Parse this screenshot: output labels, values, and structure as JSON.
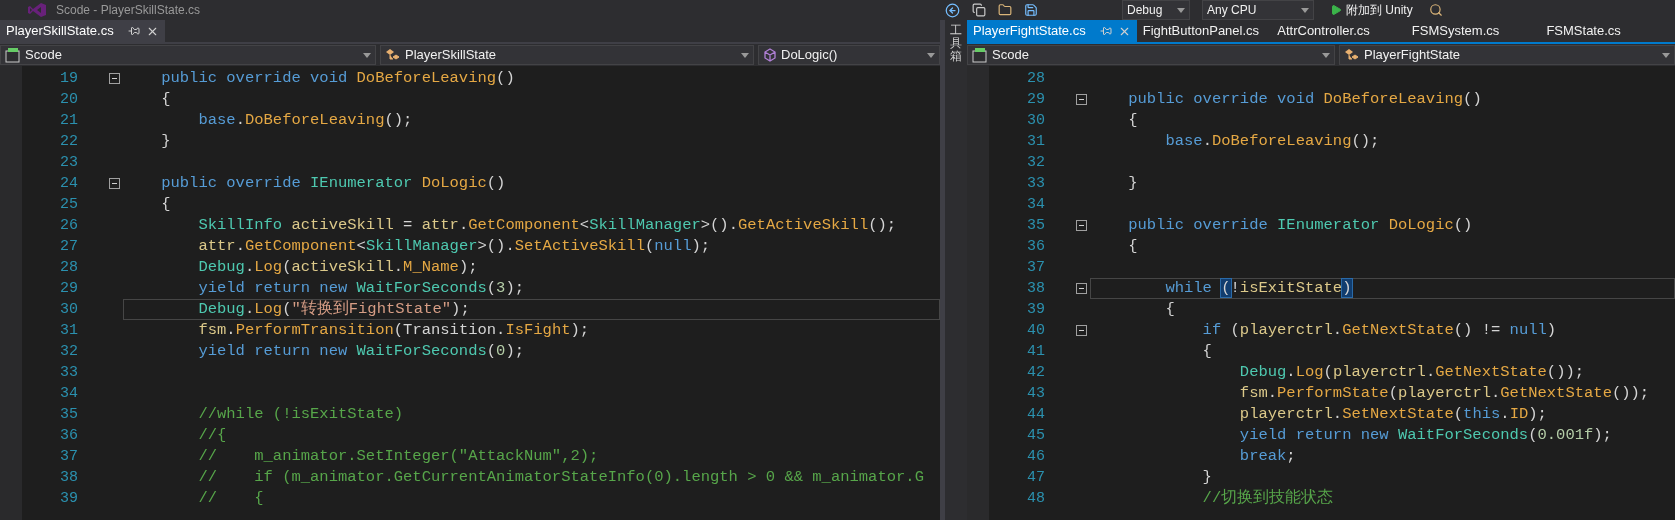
{
  "title_bar": {
    "title": "Scode - PlayerSkillState.cs"
  },
  "toolbar": {
    "configuration": "Debug",
    "platform": "Any CPU",
    "start_button": "附加到 Unity"
  },
  "toolbox_tab": "工具箱",
  "panes": [
    {
      "focused": false,
      "tabs": [
        {
          "label": "PlayerSkillState.cs",
          "selected": true
        }
      ],
      "navigation": [
        {
          "kind": "project",
          "label": "Scode"
        },
        {
          "kind": "class",
          "label": "PlayerSkillState"
        },
        {
          "kind": "member",
          "label": "DoLogic()"
        }
      ],
      "lines": [
        {
          "number": "19",
          "fold": true,
          "current": false,
          "tokens": [
            {
              "kind": "kw",
              "text": "    public override void "
            },
            {
              "kind": "method",
              "text": "DoBeforeLeaving"
            },
            {
              "kind": "plain",
              "text": "()"
            }
          ]
        },
        {
          "number": "20",
          "fold": false,
          "current": false,
          "tokens": [
            {
              "kind": "plain",
              "text": "    {"
            }
          ]
        },
        {
          "number": "21",
          "fold": false,
          "current": false,
          "tokens": [
            {
              "kind": "kw",
              "text": "        base"
            },
            {
              "kind": "plain",
              "text": "."
            },
            {
              "kind": "method",
              "text": "DoBeforeLeaving"
            },
            {
              "kind": "plain",
              "text": "();"
            }
          ]
        },
        {
          "number": "22",
          "fold": false,
          "current": false,
          "tokens": [
            {
              "kind": "plain",
              "text": "    }"
            }
          ]
        },
        {
          "number": "23",
          "fold": false,
          "current": false
        },
        {
          "number": "24",
          "fold": true,
          "current": false,
          "tokens": [
            {
              "kind": "kw",
              "text": "    public override "
            },
            {
              "kind": "type",
              "text": "IEnumerator "
            },
            {
              "kind": "method",
              "text": "DoLogic"
            },
            {
              "kind": "plain",
              "text": "()"
            }
          ]
        },
        {
          "number": "25",
          "fold": false,
          "current": false,
          "tokens": [
            {
              "kind": "plain",
              "text": "    {"
            }
          ]
        },
        {
          "number": "26",
          "fold": false,
          "current": false,
          "tokens": [
            {
              "kind": "type",
              "text": "        SkillInfo "
            },
            {
              "kind": "ident",
              "text": "activeSkill"
            },
            {
              "kind": "plain",
              "text": " = "
            },
            {
              "kind": "ident",
              "text": "attr"
            },
            {
              "kind": "plain",
              "text": "."
            },
            {
              "kind": "method",
              "text": "GetComponent"
            },
            {
              "kind": "plain",
              "text": "<"
            },
            {
              "kind": "type",
              "text": "SkillManager"
            },
            {
              "kind": "plain",
              "text": ">()."
            },
            {
              "kind": "method",
              "text": "GetActiveSkill"
            },
            {
              "kind": "plain",
              "text": "();"
            }
          ]
        },
        {
          "number": "27",
          "fold": false,
          "current": false,
          "tokens": [
            {
              "kind": "ident",
              "text": "        attr"
            },
            {
              "kind": "plain",
              "text": "."
            },
            {
              "kind": "method",
              "text": "GetComponent"
            },
            {
              "kind": "plain",
              "text": "<"
            },
            {
              "kind": "type",
              "text": "SkillManager"
            },
            {
              "kind": "plain",
              "text": ">()."
            },
            {
              "kind": "method",
              "text": "SetActiveSkill"
            },
            {
              "kind": "plain",
              "text": "("
            },
            {
              "kind": "kw",
              "text": "null"
            },
            {
              "kind": "plain",
              "text": ");"
            }
          ]
        },
        {
          "number": "28",
          "fold": false,
          "current": false,
          "tokens": [
            {
              "kind": "type",
              "text": "        Debug"
            },
            {
              "kind": "plain",
              "text": "."
            },
            {
              "kind": "method",
              "text": "Log"
            },
            {
              "kind": "plain",
              "text": "("
            },
            {
              "kind": "ident",
              "text": "activeSkill"
            },
            {
              "kind": "plain",
              "text": "."
            },
            {
              "kind": "method",
              "text": "M_Name"
            },
            {
              "kind": "plain",
              "text": ");"
            }
          ]
        },
        {
          "number": "29",
          "fold": false,
          "current": false,
          "tokens": [
            {
              "kind": "kw",
              "text": "        yield return new "
            },
            {
              "kind": "type",
              "text": "WaitForSeconds"
            },
            {
              "kind": "plain",
              "text": "("
            },
            {
              "kind": "num",
              "text": "3"
            },
            {
              "kind": "plain",
              "text": ");"
            }
          ]
        },
        {
          "number": "30",
          "fold": false,
          "current": true,
          "tokens": [
            {
              "kind": "type",
              "text": "        Debug"
            },
            {
              "kind": "plain",
              "text": "."
            },
            {
              "kind": "method",
              "text": "Log"
            },
            {
              "kind": "plain",
              "text": "("
            },
            {
              "kind": "str",
              "text": "\"转换到FightState\""
            },
            {
              "kind": "plain",
              "text": ");"
            }
          ]
        },
        {
          "number": "31",
          "fold": false,
          "current": false,
          "tokens": [
            {
              "kind": "ident",
              "text": "        fsm"
            },
            {
              "kind": "plain",
              "text": "."
            },
            {
              "kind": "method",
              "text": "PerformTransition"
            },
            {
              "kind": "plain",
              "text": "(Transition."
            },
            {
              "kind": "method",
              "text": "IsFight"
            },
            {
              "kind": "plain",
              "text": ");"
            }
          ]
        },
        {
          "number": "32",
          "fold": false,
          "current": false,
          "tokens": [
            {
              "kind": "kw",
              "text": "        yield return new "
            },
            {
              "kind": "type",
              "text": "WaitForSeconds"
            },
            {
              "kind": "plain",
              "text": "("
            },
            {
              "kind": "num",
              "text": "0"
            },
            {
              "kind": "plain",
              "text": ");"
            }
          ]
        },
        {
          "number": "33",
          "fold": false,
          "current": false
        },
        {
          "number": "34",
          "fold": false,
          "current": false
        },
        {
          "number": "35",
          "fold": false,
          "current": false,
          "tokens": [
            {
              "kind": "comment",
              "text": "        //while (!isExitState)"
            }
          ]
        },
        {
          "number": "36",
          "fold": false,
          "current": false,
          "tokens": [
            {
              "kind": "comment",
              "text": "        //{"
            }
          ]
        },
        {
          "number": "37",
          "fold": false,
          "current": false,
          "tokens": [
            {
              "kind": "comment",
              "text": "        //    m_animator.SetInteger(\"AttackNum\",2);"
            }
          ]
        },
        {
          "number": "38",
          "fold": false,
          "current": false,
          "tokens": [
            {
              "kind": "comment",
              "text": "        //    if (m_animator.GetCurrentAnimatorStateInfo(0).length > 0 && m_animator.G"
            }
          ]
        },
        {
          "number": "39",
          "fold": false,
          "current": false,
          "tokens": [
            {
              "kind": "comment",
              "text": "        //    {"
            }
          ]
        }
      ]
    },
    {
      "focused": true,
      "tabs": [
        {
          "label": "PlayerFightState.cs",
          "selected": true
        },
        {
          "label": "FightButtonPanel.cs",
          "selected": false
        },
        {
          "label": "AttrController.cs",
          "selected": false
        },
        {
          "label": "FSMSystem.cs",
          "selected": false
        },
        {
          "label": "FSMState.cs",
          "selected": false
        }
      ],
      "navigation": [
        {
          "kind": "project",
          "label": "Scode"
        },
        {
          "kind": "class",
          "label": "PlayerFightState"
        }
      ],
      "lines": [
        {
          "number": "28",
          "fold": false,
          "current": false
        },
        {
          "number": "29",
          "fold": true,
          "current": false,
          "tokens": [
            {
              "kind": "kw",
              "text": "    public override void "
            },
            {
              "kind": "method",
              "text": "DoBeforeLeaving"
            },
            {
              "kind": "plain",
              "text": "()"
            }
          ]
        },
        {
          "number": "30",
          "fold": false,
          "current": false,
          "tokens": [
            {
              "kind": "plain",
              "text": "    {"
            }
          ]
        },
        {
          "number": "31",
          "fold": false,
          "current": false,
          "tokens": [
            {
              "kind": "kw",
              "text": "        base"
            },
            {
              "kind": "plain",
              "text": "."
            },
            {
              "kind": "method",
              "text": "DoBeforeLeaving"
            },
            {
              "kind": "plain",
              "text": "();"
            }
          ]
        },
        {
          "number": "32",
          "fold": false,
          "current": false
        },
        {
          "number": "33",
          "fold": false,
          "current": false,
          "tokens": [
            {
              "kind": "plain",
              "text": "    }"
            }
          ]
        },
        {
          "number": "34",
          "fold": false,
          "current": false
        },
        {
          "number": "35",
          "fold": true,
          "current": false,
          "tokens": [
            {
              "kind": "kw",
              "text": "    public override "
            },
            {
              "kind": "type",
              "text": "IEnumerator "
            },
            {
              "kind": "method",
              "text": "DoLogic"
            },
            {
              "kind": "plain",
              "text": "()"
            }
          ]
        },
        {
          "number": "36",
          "fold": false,
          "current": false,
          "tokens": [
            {
              "kind": "plain",
              "text": "    {"
            }
          ]
        },
        {
          "number": "37",
          "fold": false,
          "current": false
        },
        {
          "number": "38",
          "fold": true,
          "current": true,
          "tokens": [
            {
              "kind": "kw",
              "text": "        while "
            },
            {
              "kind": "brace",
              "text": "("
            },
            {
              "kind": "plain",
              "text": "!"
            },
            {
              "kind": "ident",
              "text": "isExitState"
            },
            {
              "kind": "brace",
              "text": ")"
            }
          ]
        },
        {
          "number": "39",
          "fold": false,
          "current": false,
          "tokens": [
            {
              "kind": "plain",
              "text": "        {"
            }
          ]
        },
        {
          "number": "40",
          "fold": true,
          "current": false,
          "tokens": [
            {
              "kind": "kw",
              "text": "            if "
            },
            {
              "kind": "plain",
              "text": "("
            },
            {
              "kind": "ident",
              "text": "playerctrl"
            },
            {
              "kind": "plain",
              "text": "."
            },
            {
              "kind": "method",
              "text": "GetNextState"
            },
            {
              "kind": "plain",
              "text": "() != "
            },
            {
              "kind": "kw",
              "text": "null"
            },
            {
              "kind": "plain",
              "text": ")"
            }
          ]
        },
        {
          "number": "41",
          "fold": false,
          "current": false,
          "tokens": [
            {
              "kind": "plain",
              "text": "            {"
            }
          ]
        },
        {
          "number": "42",
          "fold": false,
          "current": false,
          "tokens": [
            {
              "kind": "type",
              "text": "                Debug"
            },
            {
              "kind": "plain",
              "text": "."
            },
            {
              "kind": "method",
              "text": "Log"
            },
            {
              "kind": "plain",
              "text": "("
            },
            {
              "kind": "ident",
              "text": "playerctrl"
            },
            {
              "kind": "plain",
              "text": "."
            },
            {
              "kind": "method",
              "text": "GetNextState"
            },
            {
              "kind": "plain",
              "text": "());"
            }
          ]
        },
        {
          "number": "43",
          "fold": false,
          "current": false,
          "tokens": [
            {
              "kind": "ident",
              "text": "                fsm"
            },
            {
              "kind": "plain",
              "text": "."
            },
            {
              "kind": "method",
              "text": "PerformState"
            },
            {
              "kind": "plain",
              "text": "("
            },
            {
              "kind": "ident",
              "text": "playerctrl"
            },
            {
              "kind": "plain",
              "text": "."
            },
            {
              "kind": "method",
              "text": "GetNextState"
            },
            {
              "kind": "plain",
              "text": "());"
            }
          ]
        },
        {
          "number": "44",
          "fold": false,
          "current": false,
          "tokens": [
            {
              "kind": "ident",
              "text": "                playerctrl"
            },
            {
              "kind": "plain",
              "text": "."
            },
            {
              "kind": "method",
              "text": "SetNextState"
            },
            {
              "kind": "plain",
              "text": "("
            },
            {
              "kind": "kw",
              "text": "this"
            },
            {
              "kind": "plain",
              "text": "."
            },
            {
              "kind": "method",
              "text": "ID"
            },
            {
              "kind": "plain",
              "text": ");"
            }
          ]
        },
        {
          "number": "45",
          "fold": false,
          "current": false,
          "tokens": [
            {
              "kind": "kw",
              "text": "                yield return new "
            },
            {
              "kind": "type",
              "text": "WaitForSeconds"
            },
            {
              "kind": "plain",
              "text": "("
            },
            {
              "kind": "num",
              "text": "0.001f"
            },
            {
              "kind": "plain",
              "text": ");"
            }
          ]
        },
        {
          "number": "46",
          "fold": false,
          "current": false,
          "tokens": [
            {
              "kind": "kw",
              "text": "                break"
            },
            {
              "kind": "plain",
              "text": ";"
            }
          ]
        },
        {
          "number": "47",
          "fold": false,
          "current": false,
          "tokens": [
            {
              "kind": "plain",
              "text": "            }"
            }
          ]
        },
        {
          "number": "48",
          "fold": false,
          "current": false,
          "tokens": [
            {
              "kind": "comment",
              "text": "            //切换到技能状态"
            }
          ]
        }
      ]
    }
  ]
}
